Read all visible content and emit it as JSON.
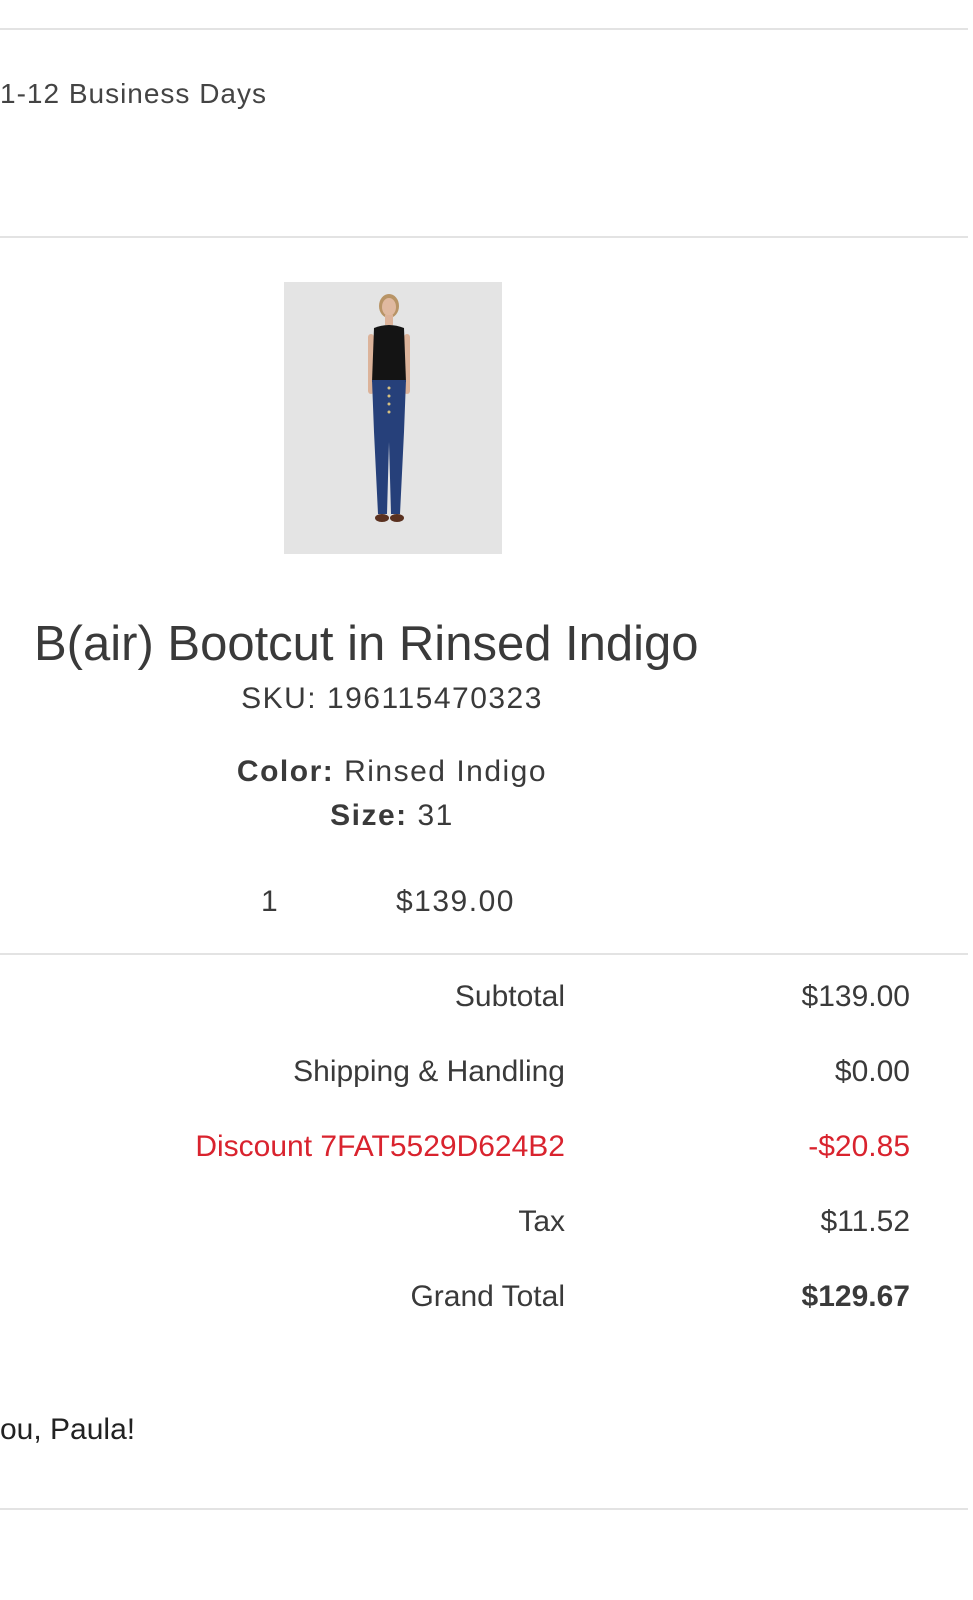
{
  "shipping": {
    "delivery_text": "1-12 Business Days"
  },
  "item": {
    "name": "B(air) Bootcut in Rinsed Indigo",
    "sku_label": "SKU:",
    "sku_value": "196115470323",
    "color_label": "Color:",
    "color_value": "Rinsed Indigo",
    "size_label": "Size:",
    "size_value": "31",
    "quantity": "1",
    "price": "$139.00"
  },
  "totals": {
    "subtotal_label": "Subtotal",
    "subtotal_value": "$139.00",
    "shipping_label": "Shipping & Handling",
    "shipping_value": "$0.00",
    "discount_label": "Discount 7FAT5529D624B2",
    "discount_value": "-$20.85",
    "tax_label": "Tax",
    "tax_value": "$11.52",
    "grand_total_label": "Grand Total",
    "grand_total_value": "$129.67"
  },
  "footer": {
    "thanks_text": "ou, Paula!"
  },
  "colors": {
    "discount": "#d9232e",
    "divider": "#e3e3e3"
  }
}
